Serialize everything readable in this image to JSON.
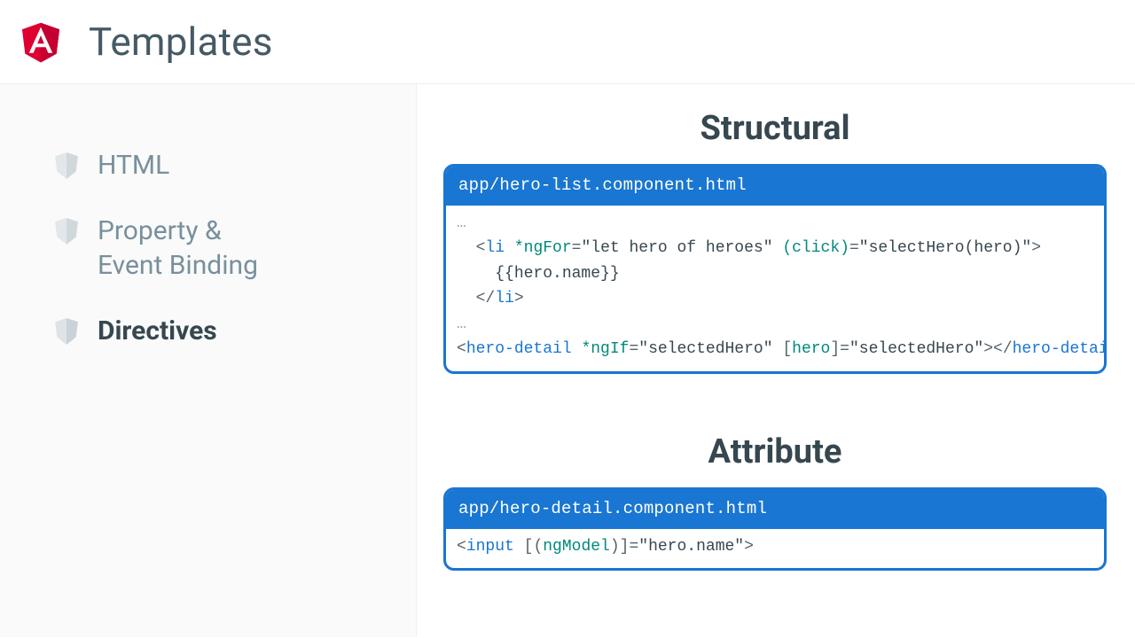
{
  "header": {
    "title": "Templates",
    "logo_name": "angular-logo"
  },
  "sidebar": {
    "items": [
      {
        "label": "HTML",
        "active": false
      },
      {
        "label": "Property &\nEvent Binding",
        "active": false
      },
      {
        "label": "Directives",
        "active": true
      }
    ]
  },
  "content": {
    "sections": [
      {
        "title": "Structural",
        "file": "app/hero-list.component.html",
        "code_tokens": [
          {
            "t": "ellip",
            "v": "…"
          },
          {
            "t": "nl"
          },
          {
            "t": "txt",
            "v": "  "
          },
          {
            "t": "punc",
            "v": "<"
          },
          {
            "t": "tag",
            "v": "li"
          },
          {
            "t": "txt",
            "v": " "
          },
          {
            "t": "attr",
            "v": "*ngFor"
          },
          {
            "t": "punc",
            "v": "="
          },
          {
            "t": "str",
            "v": "\"let hero of heroes\""
          },
          {
            "t": "txt",
            "v": " "
          },
          {
            "t": "attr",
            "v": "(click)"
          },
          {
            "t": "punc",
            "v": "="
          },
          {
            "t": "str",
            "v": "\"selectHero(hero)\""
          },
          {
            "t": "punc",
            "v": ">"
          },
          {
            "t": "nl"
          },
          {
            "t": "txt",
            "v": "    "
          },
          {
            "t": "curly",
            "v": "{{hero.name}}"
          },
          {
            "t": "nl"
          },
          {
            "t": "txt",
            "v": "  "
          },
          {
            "t": "punc",
            "v": "</"
          },
          {
            "t": "tag",
            "v": "li"
          },
          {
            "t": "punc",
            "v": ">"
          },
          {
            "t": "nl"
          },
          {
            "t": "ellip",
            "v": "…"
          },
          {
            "t": "nl"
          },
          {
            "t": "punc",
            "v": "<"
          },
          {
            "t": "tag",
            "v": "hero-detail"
          },
          {
            "t": "txt",
            "v": " "
          },
          {
            "t": "attr",
            "v": "*ngIf"
          },
          {
            "t": "punc",
            "v": "="
          },
          {
            "t": "str",
            "v": "\"selectedHero\""
          },
          {
            "t": "txt",
            "v": " "
          },
          {
            "t": "punc",
            "v": "["
          },
          {
            "t": "attr",
            "v": "hero"
          },
          {
            "t": "punc",
            "v": "]="
          },
          {
            "t": "str",
            "v": "\"selectedHero\""
          },
          {
            "t": "punc",
            "v": ">"
          },
          {
            "t": "punc",
            "v": "</"
          },
          {
            "t": "tag",
            "v": "hero-detail"
          },
          {
            "t": "punc",
            "v": ">"
          }
        ]
      },
      {
        "title": "Attribute",
        "file": "app/hero-detail.component.html",
        "code_tokens": [
          {
            "t": "punc",
            "v": "<"
          },
          {
            "t": "tag",
            "v": "input"
          },
          {
            "t": "txt",
            "v": " "
          },
          {
            "t": "punc",
            "v": "[("
          },
          {
            "t": "attr",
            "v": "ngModel"
          },
          {
            "t": "punc",
            "v": ")]="
          },
          {
            "t": "str",
            "v": "\"hero.name\""
          },
          {
            "t": "punc",
            "v": ">"
          }
        ]
      }
    ]
  },
  "colors": {
    "accent": "#1976d2",
    "sidebar_bg": "#fafafa",
    "muted_text": "#78909c",
    "shield_red": "#DD0031",
    "shield_dark": "#C3002F"
  }
}
